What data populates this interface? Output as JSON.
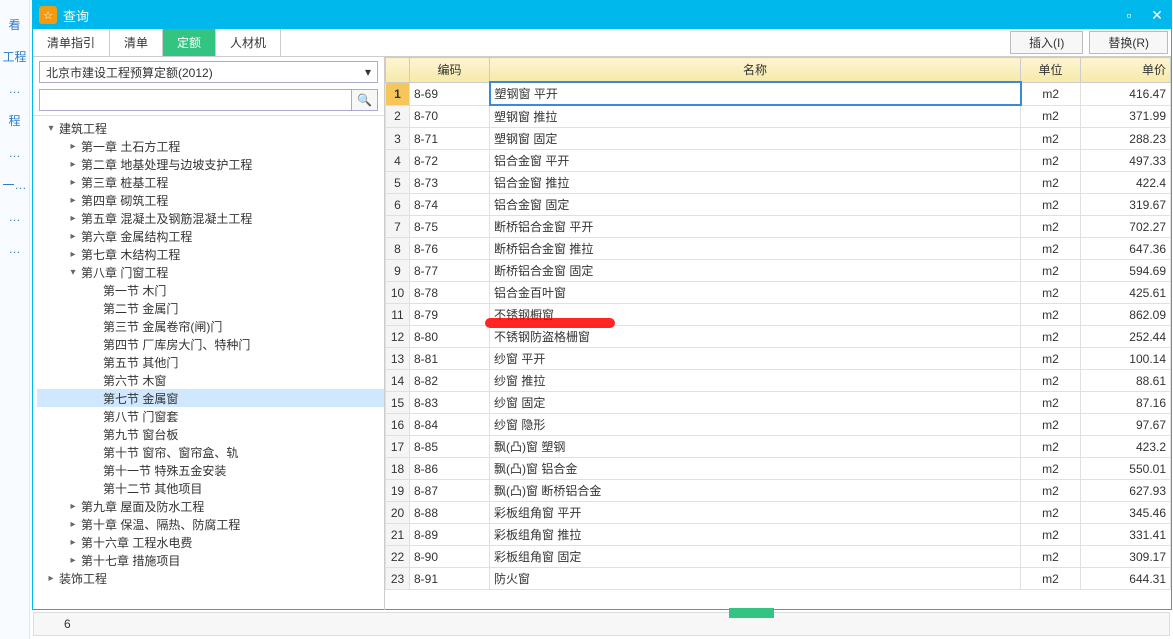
{
  "window": {
    "title": "查询",
    "minimize_label": "▫",
    "close_label": "✕"
  },
  "toolbar": {
    "tabs": [
      {
        "label": "清单指引"
      },
      {
        "label": "清单"
      },
      {
        "label": "定额"
      },
      {
        "label": "人材机"
      }
    ],
    "active_tab": 2,
    "insert_label": "插入(I)",
    "replace_label": "替换(R)"
  },
  "combo": {
    "selected": "北京市建设工程预算定额(2012)",
    "caret": "▾"
  },
  "search": {
    "placeholder": "",
    "icon": "🔍"
  },
  "tree": [
    {
      "indent": 0,
      "tog": "v",
      "label": "建筑工程"
    },
    {
      "indent": 1,
      "tog": ">",
      "label": "第一章 土石方工程"
    },
    {
      "indent": 1,
      "tog": ">",
      "label": "第二章 地基处理与边坡支护工程"
    },
    {
      "indent": 1,
      "tog": ">",
      "label": "第三章 桩基工程"
    },
    {
      "indent": 1,
      "tog": ">",
      "label": "第四章 砌筑工程"
    },
    {
      "indent": 1,
      "tog": ">",
      "label": "第五章 混凝土及钢筋混凝土工程"
    },
    {
      "indent": 1,
      "tog": ">",
      "label": "第六章 金属结构工程"
    },
    {
      "indent": 1,
      "tog": ">",
      "label": "第七章 木结构工程"
    },
    {
      "indent": 1,
      "tog": "v",
      "label": "第八章 门窗工程"
    },
    {
      "indent": 2,
      "tog": "",
      "label": "第一节 木门"
    },
    {
      "indent": 2,
      "tog": "",
      "label": "第二节 金属门"
    },
    {
      "indent": 2,
      "tog": "",
      "label": "第三节 金属卷帘(闸)门"
    },
    {
      "indent": 2,
      "tog": "",
      "label": "第四节 厂库房大门、特种门"
    },
    {
      "indent": 2,
      "tog": "",
      "label": "第五节 其他门"
    },
    {
      "indent": 2,
      "tog": "",
      "label": "第六节 木窗"
    },
    {
      "indent": 2,
      "tog": "",
      "label": "第七节 金属窗",
      "selected": true
    },
    {
      "indent": 2,
      "tog": "",
      "label": "第八节 门窗套"
    },
    {
      "indent": 2,
      "tog": "",
      "label": "第九节 窗台板"
    },
    {
      "indent": 2,
      "tog": "",
      "label": "第十节 窗帘、窗帘盒、轨"
    },
    {
      "indent": 2,
      "tog": "",
      "label": "第十一节 特殊五金安装"
    },
    {
      "indent": 2,
      "tog": "",
      "label": "第十二节 其他项目"
    },
    {
      "indent": 1,
      "tog": ">",
      "label": "第九章 屋面及防水工程"
    },
    {
      "indent": 1,
      "tog": ">",
      "label": "第十章 保温、隔热、防腐工程"
    },
    {
      "indent": 1,
      "tog": ">",
      "label": "第十六章 工程水电费"
    },
    {
      "indent": 1,
      "tog": ">",
      "label": "第十七章 措施项目"
    },
    {
      "indent": 0,
      "tog": ">",
      "label": "装饰工程"
    }
  ],
  "grid": {
    "headers": {
      "rownum": "",
      "code": "编码",
      "name": "名称",
      "unit": "单位",
      "price": "单价"
    },
    "rows": [
      {
        "n": 1,
        "code": "8-69",
        "name": "塑钢窗 平开",
        "unit": "m2",
        "price": "416.47",
        "sel": true
      },
      {
        "n": 2,
        "code": "8-70",
        "name": "塑钢窗 推拉",
        "unit": "m2",
        "price": "371.99"
      },
      {
        "n": 3,
        "code": "8-71",
        "name": "塑钢窗 固定",
        "unit": "m2",
        "price": "288.23"
      },
      {
        "n": 4,
        "code": "8-72",
        "name": "铝合金窗 平开",
        "unit": "m2",
        "price": "497.33"
      },
      {
        "n": 5,
        "code": "8-73",
        "name": "铝合金窗 推拉",
        "unit": "m2",
        "price": "422.4"
      },
      {
        "n": 6,
        "code": "8-74",
        "name": "铝合金窗 固定",
        "unit": "m2",
        "price": "319.67"
      },
      {
        "n": 7,
        "code": "8-75",
        "name": "断桥铝合金窗 平开",
        "unit": "m2",
        "price": "702.27"
      },
      {
        "n": 8,
        "code": "8-76",
        "name": "断桥铝合金窗 推拉",
        "unit": "m2",
        "price": "647.36"
      },
      {
        "n": 9,
        "code": "8-77",
        "name": "断桥铝合金窗 固定",
        "unit": "m2",
        "price": "594.69"
      },
      {
        "n": 10,
        "code": "8-78",
        "name": "铝合金百叶窗",
        "unit": "m2",
        "price": "425.61"
      },
      {
        "n": 11,
        "code": "8-79",
        "name": "不锈钢橱窗",
        "unit": "m2",
        "price": "862.09"
      },
      {
        "n": 12,
        "code": "8-80",
        "name": "不锈钢防盗格栅窗",
        "unit": "m2",
        "price": "252.44"
      },
      {
        "n": 13,
        "code": "8-81",
        "name": "纱窗 平开",
        "unit": "m2",
        "price": "100.14"
      },
      {
        "n": 14,
        "code": "8-82",
        "name": "纱窗 推拉",
        "unit": "m2",
        "price": "88.61"
      },
      {
        "n": 15,
        "code": "8-83",
        "name": "纱窗 固定",
        "unit": "m2",
        "price": "87.16"
      },
      {
        "n": 16,
        "code": "8-84",
        "name": "纱窗 隐形",
        "unit": "m2",
        "price": "97.67"
      },
      {
        "n": 17,
        "code": "8-85",
        "name": "飘(凸)窗 塑钢",
        "unit": "m2",
        "price": "423.2"
      },
      {
        "n": 18,
        "code": "8-86",
        "name": "飘(凸)窗 铝合金",
        "unit": "m2",
        "price": "550.01"
      },
      {
        "n": 19,
        "code": "8-87",
        "name": "飘(凸)窗 断桥铝合金",
        "unit": "m2",
        "price": "627.93"
      },
      {
        "n": 20,
        "code": "8-88",
        "name": "彩板组角窗 平开",
        "unit": "m2",
        "price": "345.46"
      },
      {
        "n": 21,
        "code": "8-89",
        "name": "彩板组角窗 推拉",
        "unit": "m2",
        "price": "331.41"
      },
      {
        "n": 22,
        "code": "8-90",
        "name": "彩板组角窗 固定",
        "unit": "m2",
        "price": "309.17"
      },
      {
        "n": 23,
        "code": "8-91",
        "name": "防火窗",
        "unit": "m2",
        "price": "644.31"
      }
    ]
  },
  "left_gutter": [
    {
      "label": "看"
    },
    {
      "label": "工程"
    },
    {
      "label": "…"
    },
    {
      "label": "程"
    },
    {
      "label": "…"
    },
    {
      "label": "一…"
    },
    {
      "label": "…"
    },
    {
      "label": "…"
    }
  ],
  "bottom": {
    "cell": "6"
  }
}
